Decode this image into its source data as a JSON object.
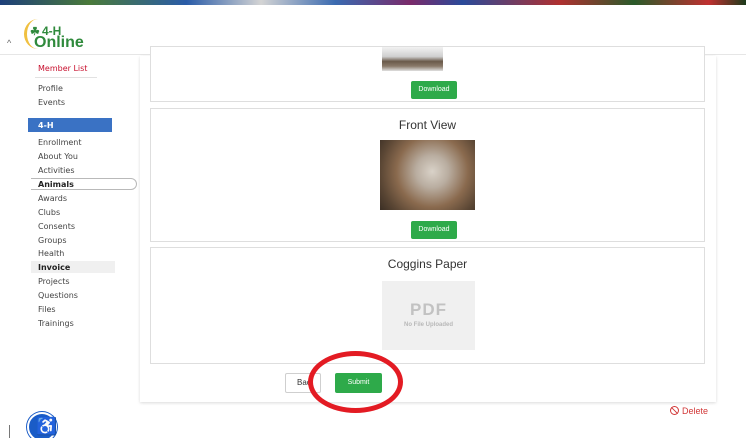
{
  "header": {
    "logo_line1": "4-H",
    "logo_line2": "Online",
    "collapse_caret": "^"
  },
  "sidebar": {
    "member_list": "Member List",
    "profile": "Profile",
    "events": "Events",
    "section_label": "4-H",
    "items": [
      "Enrollment",
      "About You",
      "Activities",
      "Animals",
      "Awards",
      "Clubs",
      "Consents",
      "Groups",
      "Health",
      "Invoice",
      "Projects",
      "Questions",
      "Files",
      "Trainings"
    ],
    "active_item": "Animals"
  },
  "cards": {
    "first": {
      "download_label": "Download"
    },
    "front_view": {
      "title": "Front View",
      "download_label": "Download"
    },
    "coggins": {
      "title": "Coggins Paper",
      "pdf_label": "PDF",
      "pdf_note": "No File Uploaded"
    }
  },
  "actions": {
    "back_label": "Bac",
    "submit_label": "Submit",
    "delete_label": "Delete"
  },
  "icons": {
    "accessibility": "accessibility-icon",
    "delete": "ban-icon"
  },
  "colors": {
    "brand_green": "#2eaa4a",
    "section_blue": "#3a72c4",
    "link_red": "#c8102e",
    "annotation_red": "#e31b23"
  }
}
